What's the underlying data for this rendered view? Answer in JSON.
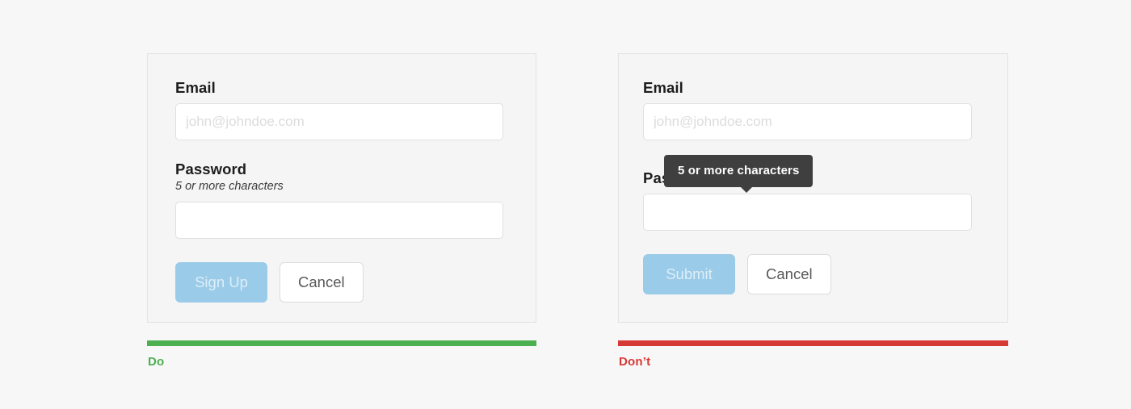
{
  "theme": {
    "page_background": "#f7f7f7",
    "panel_background": "#f5f5f5",
    "panel_border": "#e2e2e2",
    "do_color": "#4caf50",
    "dont_color": "#d63a35",
    "primary_disabled_bg": "#9acbe8",
    "tooltip_bg": "#3f3f3f"
  },
  "examples": [
    {
      "id": "do",
      "verdict_label": "Do",
      "verdict_color": "#4caf50",
      "form": {
        "email": {
          "label": "Email",
          "placeholder": "john@johndoe.com",
          "value": ""
        },
        "password": {
          "label": "Password",
          "help_text": "5 or more characters",
          "placeholder": "",
          "value": ""
        },
        "submit_button": "Sign Up",
        "cancel_button": "Cancel"
      }
    },
    {
      "id": "dont",
      "verdict_label": "Don’t",
      "verdict_color": "#d63a35",
      "form": {
        "email": {
          "label": "Email",
          "placeholder": "john@johndoe.com",
          "value": ""
        },
        "password": {
          "label": "Password",
          "help_icon": "question-mark",
          "tooltip_text": "5 or more characters",
          "placeholder": "",
          "value": ""
        },
        "submit_button": "Submit",
        "cancel_button": "Cancel"
      }
    }
  ]
}
